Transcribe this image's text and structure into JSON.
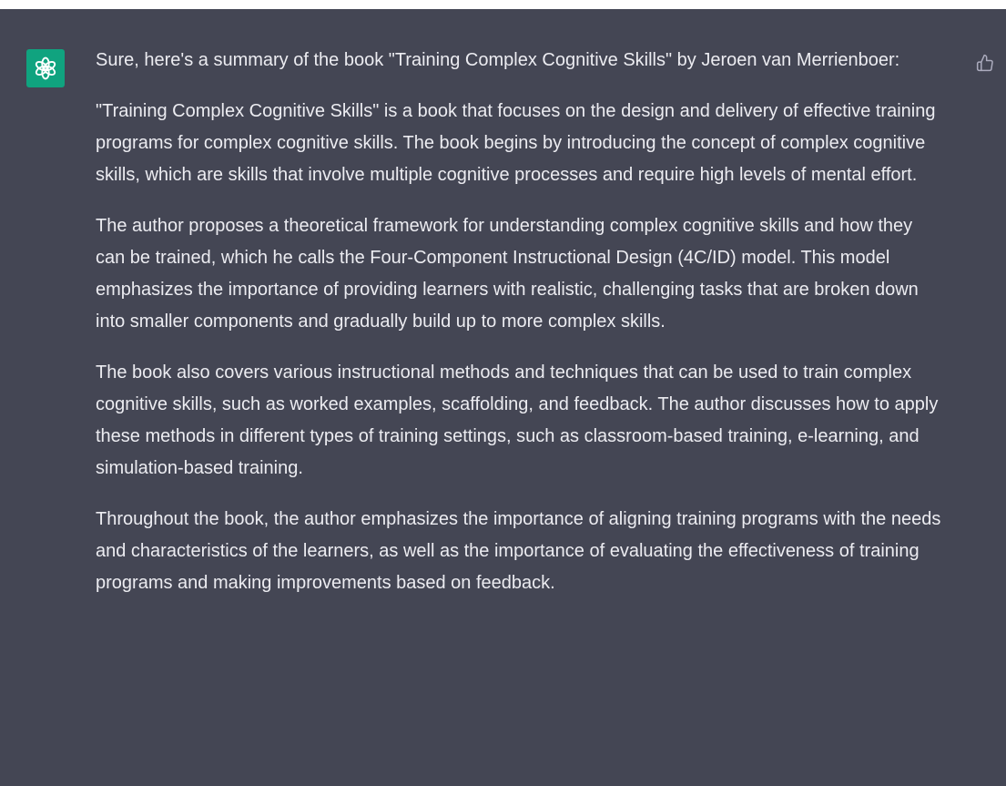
{
  "message": {
    "paragraphs": [
      "Sure, here's a summary of the book \"Training Complex Cognitive Skills\" by Jeroen van Merrienboer:",
      "\"Training Complex Cognitive Skills\" is a book that focuses on the design and delivery of effective training programs for complex cognitive skills. The book begins by introducing the concept of complex cognitive skills, which are skills that involve multiple cognitive processes and require high levels of mental effort.",
      "The author proposes a theoretical framework for understanding complex cognitive skills and how they can be trained, which he calls the Four-Component Instructional Design (4C/ID) model. This model emphasizes the importance of providing learners with realistic, challenging tasks that are broken down into smaller components and gradually build up to more complex skills.",
      "The book also covers various instructional methods and techniques that can be used to train complex cognitive skills, such as worked examples, scaffolding, and feedback. The author discusses how to apply these methods in different types of training settings, such as classroom-based training, e-learning, and simulation-based training.",
      "Throughout the book, the author emphasizes the importance of aligning training programs with the needs and characteristics of the learners, as well as the importance of evaluating the effectiveness of training programs and making improvements based on feedback."
    ]
  },
  "icons": {
    "avatar": "openai-logo-icon",
    "thumbs_up": "thumbs-up-icon",
    "thumbs_down": "thumbs-down-icon"
  },
  "colors": {
    "background": "#444654",
    "avatar": "#10a37f",
    "text": "#ececf1",
    "icon": "#acacbe"
  }
}
